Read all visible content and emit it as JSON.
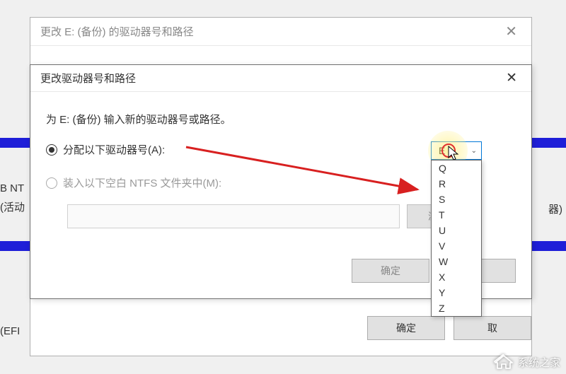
{
  "background": {
    "text_b_ntfs": "B NT",
    "text_active": "(活动",
    "text_efi": "(EFI ",
    "text_right": "器)"
  },
  "outer_dialog": {
    "title": "更改 E: (备份) 的驱动器号和路径",
    "close": "✕",
    "ok": "确定",
    "cancel": "取"
  },
  "inner_dialog": {
    "title": "更改驱动器号和路径",
    "close": "✕",
    "instruction": "为 E: (备份) 输入新的驱动器号或路径。",
    "radio_assign": "分配以下驱动器号(A):",
    "radio_mount": "装入以下空白 NTFS 文件夹中(M):",
    "browse": "浏览",
    "ok": "确定",
    "cancel": "取"
  },
  "combo": {
    "selected": "E"
  },
  "dropdown": {
    "items": [
      "Q",
      "R",
      "S",
      "T",
      "U",
      "V",
      "W",
      "X",
      "Y",
      "Z"
    ]
  },
  "watermark": {
    "text": "系统之家"
  }
}
